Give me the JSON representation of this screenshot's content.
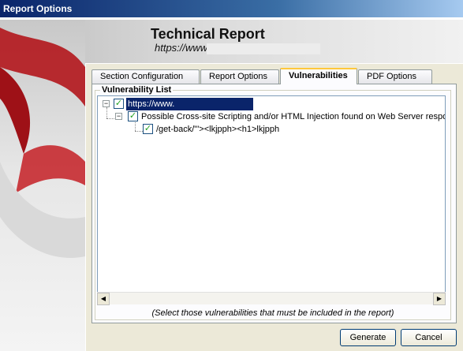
{
  "window": {
    "title": "Report Options"
  },
  "header": {
    "title": "Technical Report",
    "url": "https://www."
  },
  "tabs": [
    {
      "label": "Section Configuration"
    },
    {
      "label": "Report Options"
    },
    {
      "label": "Vulnerabilities",
      "active": true
    },
    {
      "label": "PDF Options"
    }
  ],
  "vulnerability_list": {
    "group_label": "Vulnerability List",
    "tree": [
      {
        "label": "https://www.",
        "checked": true,
        "expanded": true,
        "level": 0,
        "selected": true
      },
      {
        "label": "Possible Cross-site Scripting and/or HTML Injection found on Web Server respon",
        "checked": true,
        "expanded": true,
        "level": 1
      },
      {
        "label": "/get-back/\"'><lkjpph><h1>lkjpph",
        "checked": true,
        "level": 2
      }
    ],
    "hint": "(Select those vulnerabilities that must be included in the report)"
  },
  "buttons": {
    "generate": "Generate",
    "cancel": "Cancel"
  },
  "icons": {
    "expander": "minus-expander-icon",
    "checkbox": "check-icon",
    "scroll_left": "arrow-left-icon",
    "scroll_right": "arrow-right-icon"
  },
  "colors": {
    "title_bar": "#0a246a",
    "selection": "#0a246a",
    "check": "#21a121",
    "active_tab_highlight": "#ffc83c"
  }
}
